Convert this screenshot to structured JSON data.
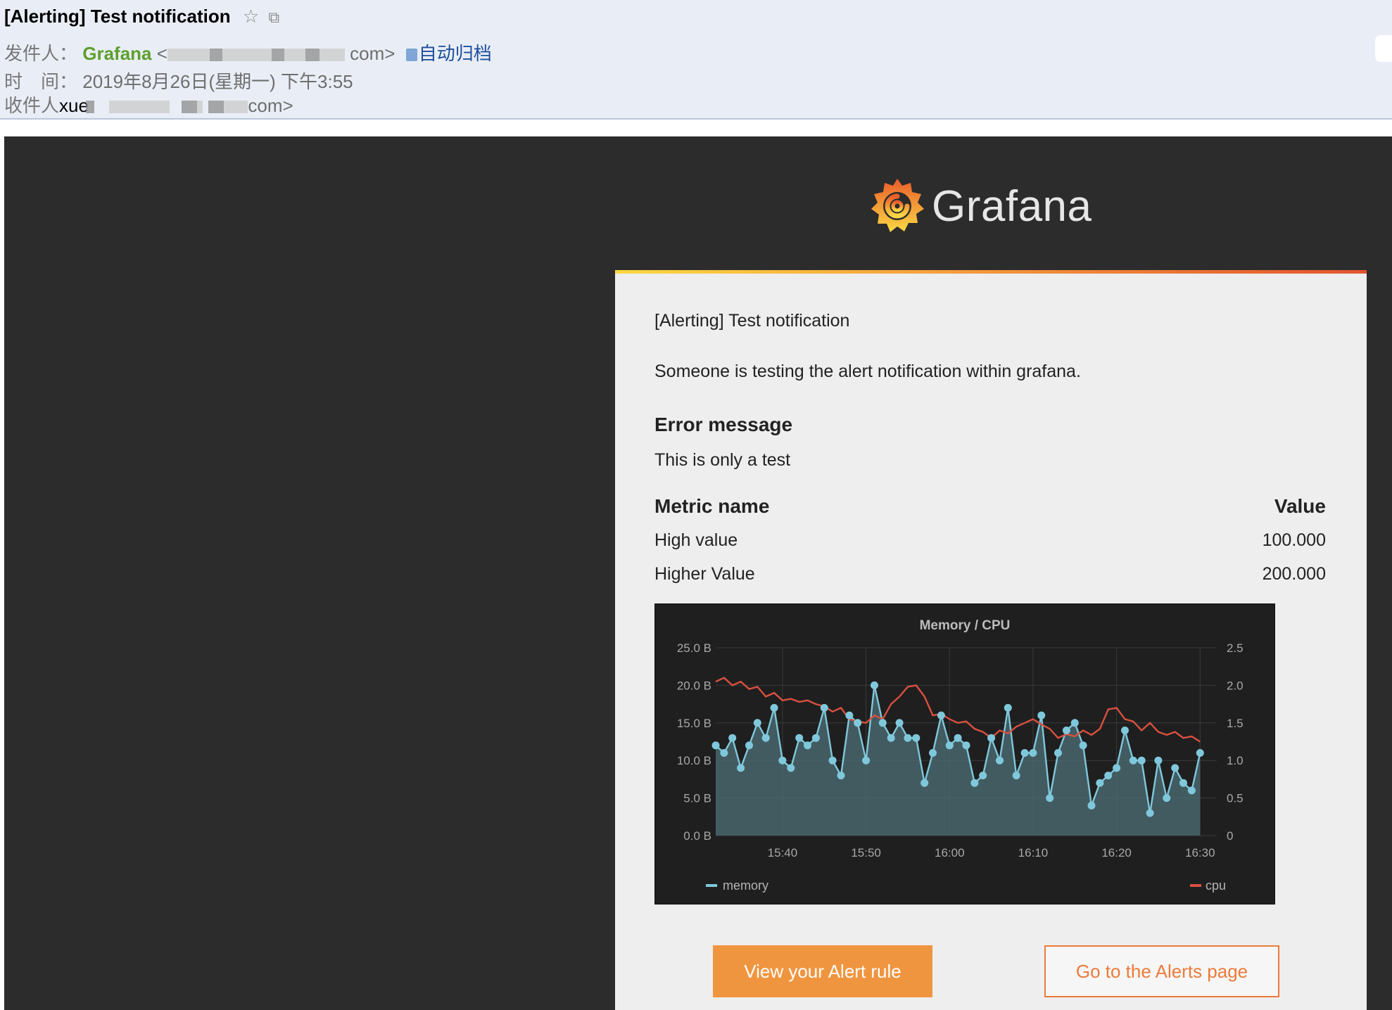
{
  "header": {
    "subject": "[Alerting] Test notification",
    "from_label": "发件人：",
    "sender_name": "Grafana",
    "sender_addr_start": "<",
    "sender_addr_end": " com>",
    "archive_label": "自动归档",
    "time_label": "时　间：",
    "time_value": "2019年8月26日(星期一) 下午3:55",
    "to_label": "收件人",
    "to_name": "xue",
    "to_addr_end": "com>"
  },
  "icons": {
    "star": "star-icon",
    "popout": "popout-icon",
    "archive": "archive-icon",
    "logo": "grafana-logo-icon"
  },
  "brand": {
    "logo_text": "Grafana",
    "orange": "#f0953f",
    "gradient": [
      "#fbd843",
      "#f59c3c",
      "#e2542f"
    ]
  },
  "card": {
    "title": "[Alerting] Test notification",
    "message": "Someone is testing the alert notification within grafana.",
    "error_heading": "Error message",
    "error_text": "This is only a test",
    "metric_heading": "Metric name",
    "value_heading": "Value",
    "metrics": [
      {
        "name": "High value",
        "value": "100.000"
      },
      {
        "name": "Higher Value",
        "value": "200.000"
      }
    ]
  },
  "chart_data": {
    "type": "line",
    "title": "Memory / CPU",
    "x_ticks": [
      "15:40",
      "15:50",
      "16:00",
      "16:10",
      "16:20",
      "16:30"
    ],
    "y_left_ticks": [
      "0.0 B",
      "5.0 B",
      "10.0 B",
      "15.0 B",
      "20.0 B",
      "25.0 B"
    ],
    "y_right_ticks": [
      "0",
      "0.5",
      "1.0",
      "1.5",
      "2.0",
      "2.5"
    ],
    "y_left_range": [
      0,
      25
    ],
    "y_right_range": [
      0,
      2.5
    ],
    "x_range_minutes": [
      0,
      60
    ],
    "x_tick_minutes": [
      8,
      18,
      28,
      38,
      48,
      58
    ],
    "grid": true,
    "legend": [
      {
        "name": "memory",
        "color": "#7fc8dc",
        "position": "bottom-left"
      },
      {
        "name": "cpu",
        "color": "#d9503f",
        "position": "bottom-right"
      }
    ],
    "series": [
      {
        "name": "memory",
        "axis": "left",
        "area": true,
        "markers": true,
        "color": "#7fc8dc",
        "x": [
          0,
          1,
          2,
          3,
          4,
          5,
          6,
          7,
          8,
          9,
          10,
          11,
          12,
          13,
          14,
          15,
          16,
          17,
          18,
          19,
          20,
          21,
          22,
          23,
          24,
          25,
          26,
          27,
          28,
          29,
          30,
          31,
          32,
          33,
          34,
          35,
          36,
          37,
          38,
          39,
          40,
          41,
          42,
          43,
          44,
          45,
          46,
          47,
          48,
          49,
          50,
          51,
          52,
          53,
          54,
          55,
          56,
          57,
          58
        ],
        "values": [
          12,
          11,
          13,
          9,
          12,
          15,
          13,
          17,
          10,
          9,
          13,
          12,
          13,
          17,
          10,
          8,
          16,
          15,
          10,
          20,
          15,
          13,
          15,
          13,
          13,
          7,
          11,
          16,
          12,
          13,
          12,
          7,
          8,
          13,
          10,
          17,
          8,
          11,
          11,
          16,
          5,
          11,
          14,
          15,
          12,
          4,
          7,
          8,
          9,
          14,
          10,
          10,
          3,
          10,
          5,
          9,
          7,
          6,
          11
        ]
      },
      {
        "name": "cpu",
        "axis": "right",
        "area": false,
        "markers": false,
        "color": "#d9503f",
        "x": [
          0,
          1,
          2,
          3,
          4,
          5,
          6,
          7,
          8,
          9,
          10,
          11,
          12,
          13,
          14,
          15,
          16,
          17,
          18,
          19,
          20,
          21,
          22,
          23,
          24,
          25,
          26,
          27,
          28,
          29,
          30,
          31,
          32,
          33,
          34,
          35,
          36,
          37,
          38,
          39,
          40,
          41,
          42,
          43,
          44,
          45,
          46,
          47,
          48,
          49,
          50,
          51,
          52,
          53,
          54,
          55,
          56,
          57,
          58
        ],
        "values": [
          2.05,
          2.1,
          2.0,
          2.05,
          1.95,
          1.98,
          1.85,
          1.9,
          1.8,
          1.82,
          1.78,
          1.8,
          1.75,
          1.72,
          1.65,
          1.7,
          1.55,
          1.52,
          1.5,
          1.6,
          1.55,
          1.75,
          1.85,
          1.98,
          2.0,
          1.85,
          1.6,
          1.62,
          1.55,
          1.5,
          1.52,
          1.42,
          1.38,
          1.3,
          1.4,
          1.36,
          1.45,
          1.5,
          1.55,
          1.48,
          1.42,
          1.3,
          1.35,
          1.32,
          1.4,
          1.34,
          1.42,
          1.68,
          1.7,
          1.55,
          1.52,
          1.4,
          1.5,
          1.38,
          1.34,
          1.38,
          1.3,
          1.32,
          1.25
        ]
      }
    ]
  },
  "buttons": {
    "view_rule": "View your Alert rule",
    "alerts_page": "Go to the Alerts page"
  }
}
